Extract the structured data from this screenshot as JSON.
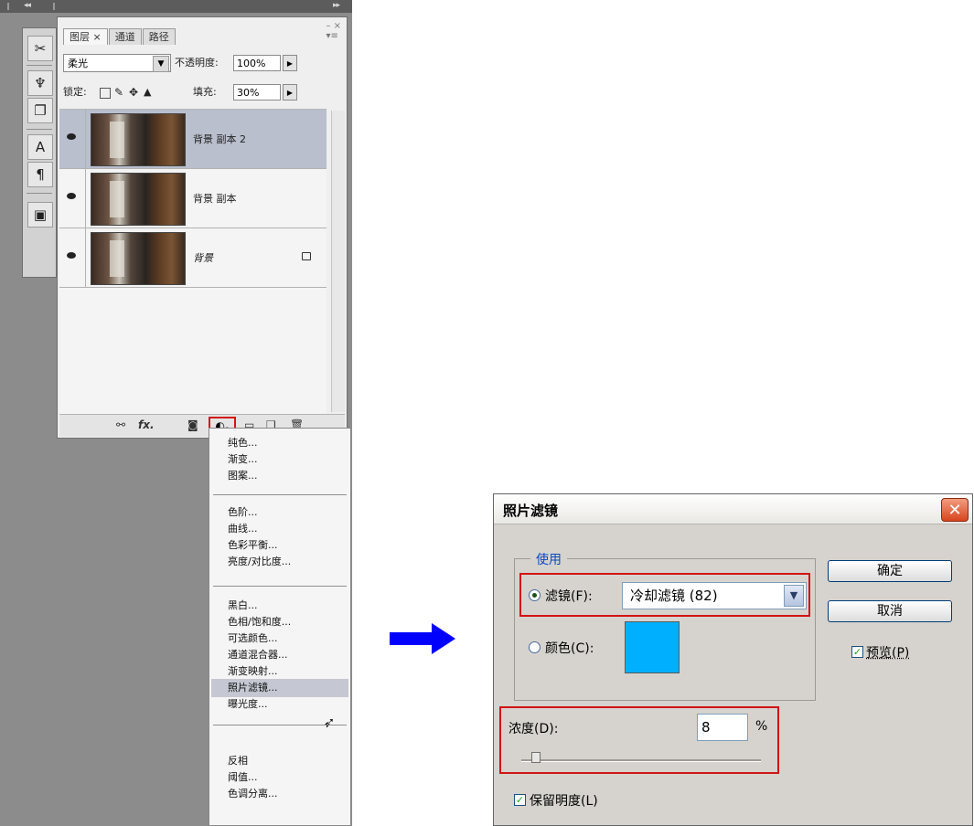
{
  "layers_panel": {
    "tabs": [
      "图层 ×",
      "通道",
      "路径"
    ],
    "blend_mode": "柔光",
    "opacity_label": "不透明度:",
    "opacity_value": "100%",
    "lock_label": "锁定:",
    "fill_label": "填充:",
    "fill_value": "30%",
    "layers": [
      {
        "name": "背景 副本 2",
        "selected": true
      },
      {
        "name": "背景 副本",
        "selected": false
      },
      {
        "name": "背景",
        "selected": false,
        "locked": true
      }
    ],
    "bottom_icons": [
      "link-icon",
      "fx-icon",
      "mask-icon",
      "adjustment-icon",
      "group-icon",
      "new-layer-icon",
      "trash-icon"
    ],
    "fx_label": "fx."
  },
  "adjustment_menu": {
    "groups": [
      [
        "纯色...",
        "渐变...",
        "图案..."
      ],
      [
        "色阶...",
        "曲线...",
        "色彩平衡...",
        "亮度/对比度..."
      ],
      [
        "黑白...",
        "色相/饱和度...",
        "可选颜色...",
        "通道混合器...",
        "渐变映射...",
        "照片滤镜...",
        "曝光度..."
      ],
      [
        "反相",
        "阈值...",
        "色调分离..."
      ]
    ],
    "highlighted": "照片滤镜..."
  },
  "dialog": {
    "title": "照片滤镜",
    "close": "✕",
    "use_group_label": "使用",
    "filter_label": "滤镜(F):",
    "filter_value": "冷却滤镜 (82)",
    "color_label": "颜色(C):",
    "color_swatch": "#00b0ff",
    "ok_button": "确定",
    "cancel_button": "取消",
    "preview_label": "预览(P)",
    "density_label": "浓度(D):",
    "density_value": "8",
    "density_unit": "%",
    "density_level_percent": 8,
    "preserve_label": "保留明度(L)"
  },
  "colors": {
    "highlight_red": "#d21414",
    "arrow_blue": "#0000ff"
  }
}
